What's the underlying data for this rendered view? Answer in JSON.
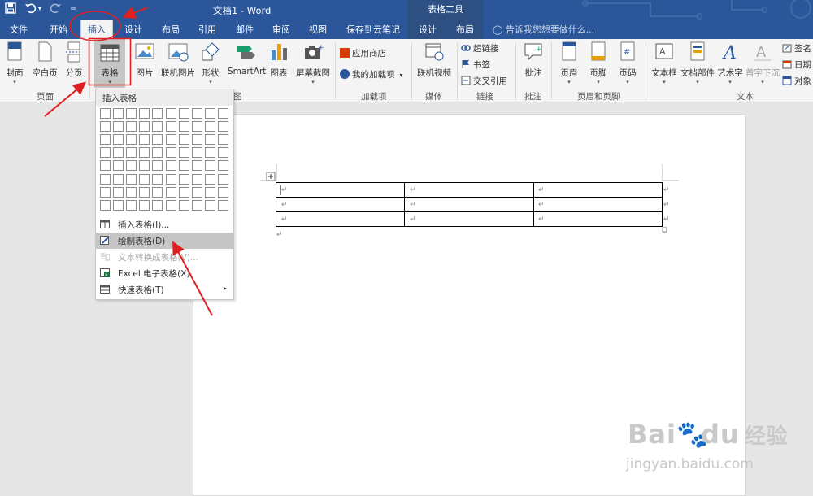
{
  "title": {
    "document": "文档1 - Word",
    "context_group": "表格工具",
    "qat_more": "="
  },
  "tabs": [
    "文件",
    "开始",
    "插入",
    "设计",
    "布局",
    "引用",
    "邮件",
    "审阅",
    "视图",
    "保存到云笔记"
  ],
  "active_tab": "插入",
  "context_tabs": [
    "设计",
    "布局"
  ],
  "tell_me": "告诉我您想要做什么...",
  "ribbon": {
    "pages": {
      "cover": "封面",
      "blank": "空白页",
      "break": "分页",
      "group": "页面"
    },
    "tables": {
      "table": "表格",
      "group_tail": "图"
    },
    "illustrations": {
      "picture": "图片",
      "online_picture": "联机图片",
      "shapes": "形状",
      "smartart": "SmartArt",
      "chart": "图表",
      "screenshot": "屏幕截图"
    },
    "addins": {
      "store": "应用商店",
      "my_addins": "我的加载项",
      "group": "加载项"
    },
    "media": {
      "online_video": "联机视频",
      "group": "媒体"
    },
    "links": {
      "hyperlink": "超链接",
      "bookmark": "书签",
      "cross_ref": "交叉引用",
      "group": "链接"
    },
    "comments": {
      "comment": "批注",
      "group": "批注"
    },
    "header_footer": {
      "header": "页眉",
      "footer": "页脚",
      "page_number": "页码",
      "group": "页眉和页脚"
    },
    "text": {
      "textbox": "文本框",
      "quick_parts": "文档部件",
      "wordart": "艺术字",
      "dropcap": "首字下沉",
      "signature": "签名",
      "datetime": "日期",
      "object": "对象",
      "group": "文本"
    }
  },
  "dropdown": {
    "header": "插入表格",
    "grid": {
      "cols": 10,
      "rows": 8
    },
    "items": [
      {
        "label": "插入表格(I)...",
        "state": "normal"
      },
      {
        "label": "绘制表格(D)",
        "state": "highlighted"
      },
      {
        "label": "文本转换成表格(V)...",
        "state": "disabled"
      },
      {
        "label": "Excel 电子表格(X)",
        "state": "normal"
      },
      {
        "label": "快速表格(T)",
        "state": "normal"
      }
    ]
  },
  "document": {
    "table_rows": 3,
    "table_cols": 3,
    "cell_mark": "↵",
    "paragraph_mark": "↵"
  },
  "watermark": {
    "brand": "Bai",
    "brand_tail": "du",
    "brand_cn": "经验",
    "url": "jingyan.baidu.com"
  },
  "colors": {
    "ribbon_blue": "#2b579a",
    "annotation_red": "#e02020",
    "highlight_gray": "#c6c6c6"
  }
}
